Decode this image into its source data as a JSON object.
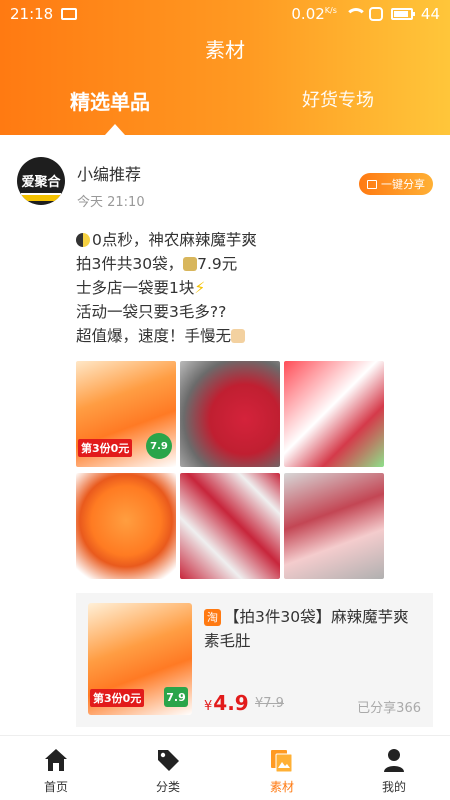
{
  "status_bar": {
    "time": "21:18",
    "speed": "0.02",
    "speed_unit": "K/s",
    "battery": "44"
  },
  "header": {
    "title": "素材"
  },
  "tabs": [
    {
      "label": "精选单品",
      "active": true
    },
    {
      "label": "好货专场",
      "active": false
    }
  ],
  "post": {
    "avatar_text": "爱聚合",
    "author": "小编推荐",
    "time": "今天 21:10",
    "share_label": "一键分享",
    "lines": [
      "0点秒，神农麻辣魔芋爽",
      "拍3件共30袋，",
      "7.9元",
      "士多店一袋要1块",
      "活动一袋只要3毛多??",
      "超值爆，速度！手慢无"
    ],
    "image_labels": {
      "promo": "第3份0元",
      "price": "7.9"
    }
  },
  "product": {
    "store_icon": "淘",
    "title": "【拍3件30袋】麻辣魔芋爽素毛肚",
    "price": "4.9",
    "currency": "¥",
    "original_price": "¥7.9",
    "shared": "已分享366",
    "promo": "第3份0元",
    "tag_price": "7.9"
  },
  "bottom_nav": [
    {
      "label": "首页",
      "icon": "home-icon"
    },
    {
      "label": "分类",
      "icon": "tag-icon"
    },
    {
      "label": "素材",
      "icon": "material-icon",
      "active": true
    },
    {
      "label": "我的",
      "icon": "profile-icon"
    }
  ],
  "colors": {
    "accent": "#ff7a12",
    "price": "#e21b1b"
  }
}
